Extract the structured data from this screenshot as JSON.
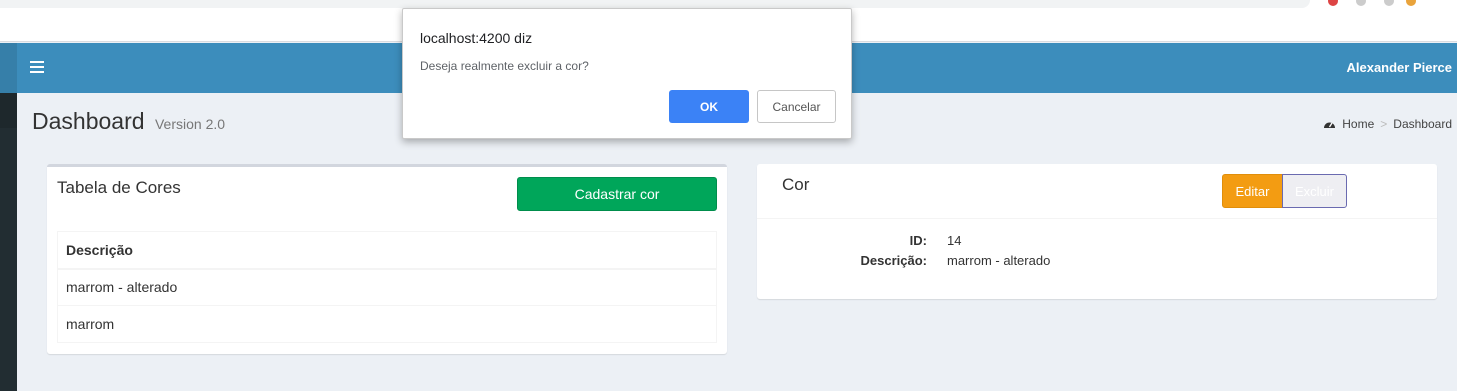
{
  "navbar": {
    "user_name": "Alexander Pierce",
    "color": "#3c8dbc"
  },
  "header": {
    "title": "Dashboard",
    "version": "Version 2.0"
  },
  "breadcrumb": {
    "home": "Home",
    "current": "Dashboard"
  },
  "left_box": {
    "title": "Tabela de Cores",
    "add_button": "Cadastrar cor",
    "table": {
      "header": "Descrição",
      "rows": [
        "marrom - alterado",
        "marrom"
      ]
    }
  },
  "right_box": {
    "title": "Cor",
    "edit_button": "Editar",
    "delete_button": "Excluir",
    "fields": [
      {
        "label": "ID:",
        "value": "14"
      },
      {
        "label": "Descrição:",
        "value": "marrom - alterado"
      }
    ]
  },
  "dialog": {
    "origin": "localhost:4200 diz",
    "message": "Deseja realmente excluir a cor?",
    "ok_label": "OK",
    "cancel_label": "Cancelar"
  }
}
